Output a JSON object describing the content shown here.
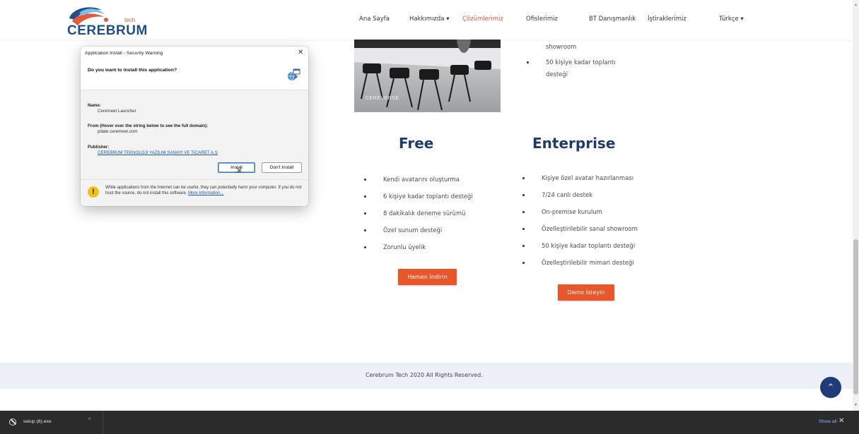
{
  "header": {
    "logo_text": "CEREBRUM",
    "logo_sub": "tech",
    "nav": [
      {
        "label": "Ana Sayfa",
        "active": false,
        "dropdown": false
      },
      {
        "label": "Hakkımızda",
        "active": false,
        "dropdown": true
      },
      {
        "label": "Çözümlerimiz",
        "active": true,
        "dropdown": false
      },
      {
        "label": "Ofislerimiz",
        "active": false,
        "dropdown": false
      },
      {
        "label": "BT Danışmanlık",
        "active": false,
        "dropdown": false
      },
      {
        "label": "İştiraklerimiz",
        "active": false,
        "dropdown": false
      },
      {
        "label": "Türkçe",
        "active": false,
        "dropdown": true
      }
    ]
  },
  "hero": {
    "watermark": "CEREVERSE",
    "top_list": [
      "showroom",
      "50 kişiye kadar toplantı",
      "desteği"
    ]
  },
  "plans": {
    "free": {
      "title": "Free",
      "features": [
        "Kendi avatarını oluşturma",
        "6 kişiye kadar toplantı desteği",
        "8 dakikalık deneme sürümü",
        "Özel sunum desteği",
        "Zorunlu üyelik"
      ],
      "cta": "Hemen İndirin"
    },
    "enterprise": {
      "title": "Enterprise",
      "features": [
        "Kişiye özel avatar hazırlanması",
        "7/24 canlı destek",
        "On-premise kurulum",
        "Özelleştirilebilir sanal showroom",
        "50 kişiye kadar toplantı desteği",
        "Özelleştirilebilir mimari desteği"
      ],
      "cta": "Demo İsteyin"
    }
  },
  "footer": {
    "text": "Cerebrum Tech 2020 All Rights Reserved."
  },
  "dialog": {
    "title": "Application Install - Security Warning",
    "question": "Do you want to install this application?",
    "name_label": "Name:",
    "name_value": "Ceremeet Launcher",
    "from_label": "From (Hover over the string below to see the full domain):",
    "from_value": "pdate.ceremeet.com",
    "publisher_label": "Publisher:",
    "publisher_value": "CEREBRUM TEKNOLOJI YAZILIM SANAYI VE TICARET A.Ş",
    "install_label": "Install",
    "dont_install_label": "Don't Install",
    "warning_text": "While applications from the Internet can be useful, they can potentially harm your computer. If you do not trust the source, do not install this software.",
    "warning_link": "More Information..."
  },
  "downloads": {
    "file_name": "setup (6).exe",
    "show_all": "Show all"
  },
  "colors": {
    "accent": "#e9562a",
    "navy": "#1f3b6e",
    "footer_bg": "#eef0f8"
  }
}
